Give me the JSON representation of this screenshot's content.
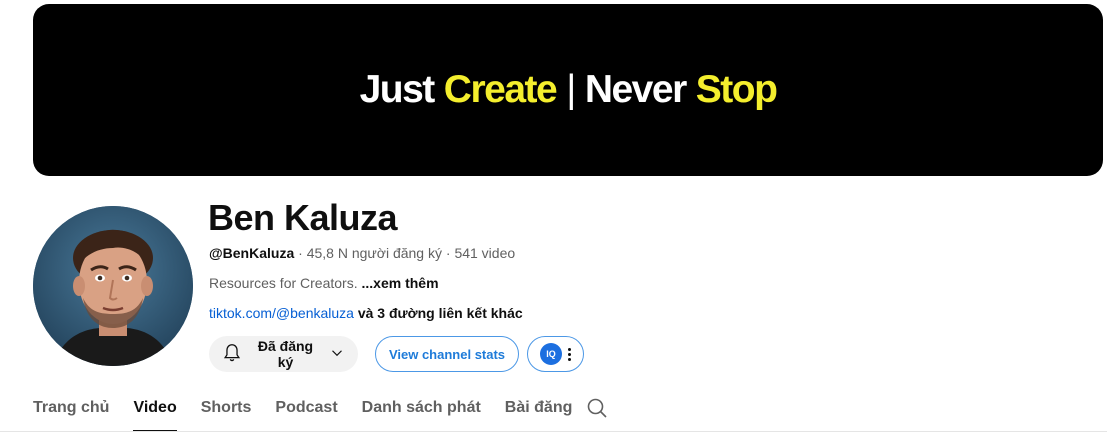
{
  "banner": {
    "part1": "Just",
    "part2": "Create",
    "separator": "|",
    "part3": "Never",
    "part4": "Stop",
    "accent_color": "#f4ee2d"
  },
  "channel": {
    "name": "Ben Kaluza",
    "handle": "@BenKaluza",
    "subscribers": "45,8 N người đăng ký",
    "video_count": "541 video",
    "dot": "·",
    "description": "Resources for Creators.",
    "more_label": "...xem thêm",
    "link": "tiktok.com/@benkaluza",
    "more_links": "và 3 đường liên kết khác"
  },
  "actions": {
    "subscribed_label": "Đã đăng ký",
    "stats_label": "View channel stats",
    "extension_badge": "IQ"
  },
  "tabs": [
    {
      "label": "Trang chủ"
    },
    {
      "label": "Video",
      "active": true
    },
    {
      "label": "Shorts"
    },
    {
      "label": "Podcast"
    },
    {
      "label": "Danh sách phát"
    },
    {
      "label": "Bài đăng"
    }
  ],
  "icons": {
    "bell": "bell-icon",
    "chevron": "chevron-down-icon",
    "search": "search-icon",
    "more": "more-vert-icon"
  }
}
